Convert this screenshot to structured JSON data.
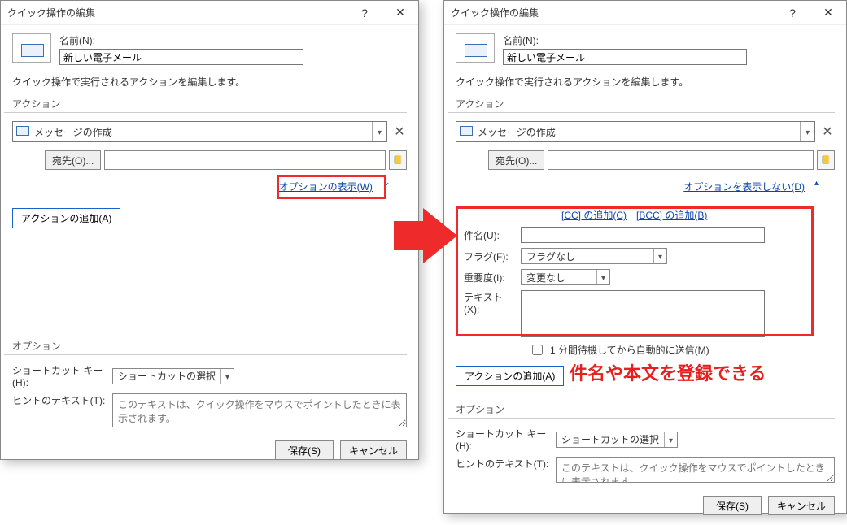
{
  "left": {
    "titlebar": {
      "title": "クイック操作の編集"
    },
    "name_label": "名前(N):",
    "name_value": "新しい電子メール",
    "description": "クイック操作で実行されるアクションを編集します。",
    "actions_label": "アクション",
    "action_select": "メッセージの作成",
    "to_button": "宛先(O)...",
    "show_options_link": "オプションの表示(W)",
    "add_action": "アクションの追加(A)",
    "options_label": "オプション",
    "shortcut_label": "ショートカット キー(H):",
    "shortcut_value": "ショートカットの選択",
    "hint_label": "ヒントのテキスト(T):",
    "hint_placeholder": "このテキストは、クイック操作をマウスでポイントしたときに表示されます。",
    "save": "保存(S)",
    "cancel": "キャンセル"
  },
  "right": {
    "titlebar": {
      "title": "クイック操作の編集"
    },
    "name_label": "名前(N):",
    "name_value": "新しい電子メール",
    "description": "クイック操作で実行されるアクションを編集します。",
    "actions_label": "アクション",
    "action_select": "メッセージの作成",
    "to_button": "宛先(O)...",
    "hide_options_link": "オプションを表示しない(D)",
    "cc_link": "[CC] の追加(C)",
    "bcc_link": "[BCC] の追加(B)",
    "subject_label": "件名(U):",
    "flag_label": "フラグ(F):",
    "flag_value": "フラグなし",
    "importance_label": "重要度(I):",
    "importance_value": "変更なし",
    "text_label": "テキスト(X):",
    "auto_send": "1 分間待機してから自動的に送信(M)",
    "add_action": "アクションの追加(A)",
    "options_label": "オプション",
    "shortcut_label": "ショートカット キー(H):",
    "shortcut_value": "ショートカットの選択",
    "hint_label": "ヒントのテキスト(T):",
    "hint_placeholder": "このテキストは、クイック操作をマウスでポイントしたときに表示されます。",
    "save": "保存(S)",
    "cancel": "キャンセル"
  },
  "annotation": "件名や本文を登録できる"
}
